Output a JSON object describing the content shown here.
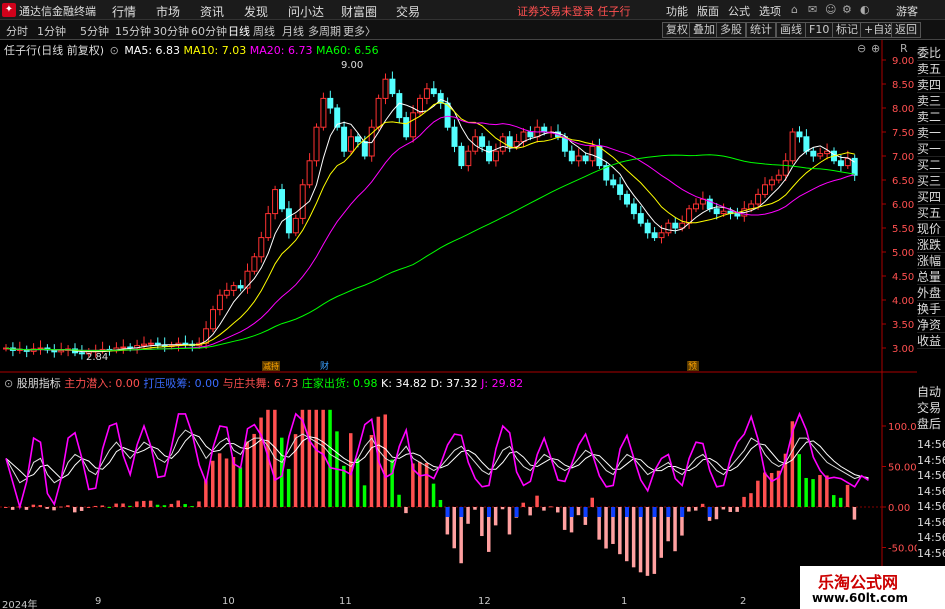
{
  "window": {
    "title": "通达信金融终端",
    "warning": "证券交易未登录 任子行",
    "guest": "游客"
  },
  "menus": [
    "行情",
    "市场",
    "资讯",
    "发现",
    "问小达",
    "财富圈",
    "交易"
  ],
  "right_menus": [
    "功能",
    "版面",
    "公式",
    "选项"
  ],
  "timeframes": [
    {
      "label": "分时"
    },
    {
      "label": "1分钟"
    },
    {
      "label": "5分钟"
    },
    {
      "label": "15分钟"
    },
    {
      "label": "30分钟"
    },
    {
      "label": "60分钟"
    },
    {
      "label": "日线",
      "active": true
    },
    {
      "label": "周线"
    },
    {
      "label": "月线"
    },
    {
      "label": "多周期"
    },
    {
      "label": "更多〉"
    }
  ],
  "toolbar_buttons": [
    "复权",
    "叠加",
    "多股",
    "统计",
    "画线",
    "F10",
    "标记",
    "+自选",
    "返回"
  ],
  "stock": {
    "name": "任子行(日线 前复权)",
    "ma5": "MA5: 6.83",
    "ma10": "MA10: 7.03",
    "ma20": "MA20: 6.73",
    "ma60": "MA60: 6.56",
    "high_label": "9.00",
    "low_label": "2.84"
  },
  "indicator": {
    "name": "股朋指标",
    "main_in": "主力潜入: 0.00",
    "pull_wash": "打压吸筹: 0.00",
    "with_dealer": "与庄共舞: 6.73",
    "dealer_out": "庄家出货: 0.98",
    "k": "K: 34.82",
    "d": "D: 37.32",
    "j": "J: 29.82"
  },
  "price_axis": [
    "9.00",
    "8.50",
    "8.00",
    "7.50",
    "7.00",
    "6.50",
    "6.00",
    "5.50",
    "5.00",
    "4.50",
    "4.00",
    "3.50",
    "3.00"
  ],
  "ind_axis": [
    "100.0",
    "50.00",
    "0.00",
    "-50.00"
  ],
  "side_top": [
    "委比",
    "卖五",
    "卖四",
    "卖三",
    "卖二",
    "卖一",
    "买一",
    "买二",
    "买三",
    "买四",
    "买五",
    "现价",
    "涨跌",
    "涨幅",
    "总量",
    "外盘",
    "换手",
    "净资",
    "收益"
  ],
  "side_lower": [
    "自动",
    "交易",
    "盘后"
  ],
  "times": [
    "14:56",
    "14:56",
    "14:56",
    "14:56",
    "14:56",
    "14:56",
    "14:56",
    "14:56"
  ],
  "x_labels": [
    "2024年",
    "9",
    "10",
    "11",
    "12",
    "1",
    "2"
  ],
  "markers": {
    "m1": "减持",
    "m2": "财",
    "m3": "预"
  },
  "watermark": {
    "cn": "乐淘公式网",
    "url": "www.60lt.com"
  },
  "colors": {
    "up": "#ff3232",
    "down": "#54ffff",
    "ma5": "#ffffff",
    "ma10": "#ffff00",
    "ma20": "#ff00ff",
    "ma60": "#00ff00"
  },
  "chart_data": {
    "type": "candlestick",
    "ylim": [
      2.7,
      9.3
    ],
    "close": [
      3.0,
      2.95,
      2.97,
      2.93,
      2.98,
      3.0,
      2.96,
      2.92,
      2.95,
      2.98,
      2.9,
      2.88,
      2.92,
      2.95,
      2.97,
      2.96,
      3.0,
      3.02,
      3.0,
      3.05,
      3.08,
      3.1,
      3.06,
      3.04,
      3.05,
      3.1,
      3.08,
      3.05,
      3.1,
      3.4,
      3.8,
      4.1,
      4.2,
      4.3,
      4.25,
      4.6,
      4.9,
      5.3,
      5.8,
      6.3,
      5.9,
      5.4,
      5.7,
      6.4,
      6.9,
      7.6,
      8.2,
      8.0,
      7.6,
      7.1,
      7.4,
      7.3,
      7.0,
      7.6,
      8.2,
      8.6,
      8.3,
      7.8,
      7.4,
      7.9,
      8.2,
      8.4,
      8.3,
      8.1,
      7.6,
      7.2,
      6.8,
      7.1,
      7.4,
      7.2,
      6.9,
      7.1,
      7.4,
      7.2,
      7.3,
      7.5,
      7.4,
      7.6,
      7.5,
      7.5,
      7.4,
      7.1,
      6.9,
      7.0,
      6.9,
      7.2,
      6.8,
      6.5,
      6.4,
      6.2,
      6.0,
      5.8,
      5.6,
      5.4,
      5.3,
      5.4,
      5.6,
      5.5,
      5.6,
      5.9,
      6.0,
      6.1,
      5.9,
      5.8,
      5.85,
      5.8,
      5.75,
      5.9,
      6.0,
      6.2,
      6.4,
      6.5,
      6.6,
      6.9,
      7.5,
      7.4,
      7.1,
      7.0,
      7.05,
      7.1,
      6.9,
      6.8,
      6.95,
      6.6
    ],
    "kdj_k": [
      60,
      45,
      30,
      35,
      55,
      60,
      40,
      30,
      35,
      55,
      65,
      60,
      45,
      40,
      55,
      70,
      80,
      70,
      60,
      70,
      80,
      75,
      60,
      55,
      65,
      85,
      95,
      90,
      75,
      60,
      70,
      80,
      85,
      70,
      65,
      80,
      85,
      85,
      75,
      60,
      55,
      70,
      85,
      90,
      85,
      80,
      75,
      65,
      60,
      55,
      50,
      60,
      75,
      85,
      70,
      60,
      55,
      65,
      75,
      60,
      55,
      50,
      45,
      50,
      60,
      70,
      75,
      65,
      55,
      45,
      40,
      55,
      70,
      75,
      60,
      50,
      45,
      55,
      65,
      60,
      50,
      45,
      50,
      60,
      70,
      65,
      55,
      45,
      40,
      55,
      65,
      60,
      50,
      40,
      45,
      50,
      55,
      45,
      40,
      50,
      60,
      65,
      55,
      45,
      40,
      50,
      60,
      70,
      85,
      80,
      65,
      55,
      50,
      55,
      70,
      85,
      85,
      75,
      65,
      55,
      50,
      45,
      40,
      35,
      38,
      35
    ]
  }
}
